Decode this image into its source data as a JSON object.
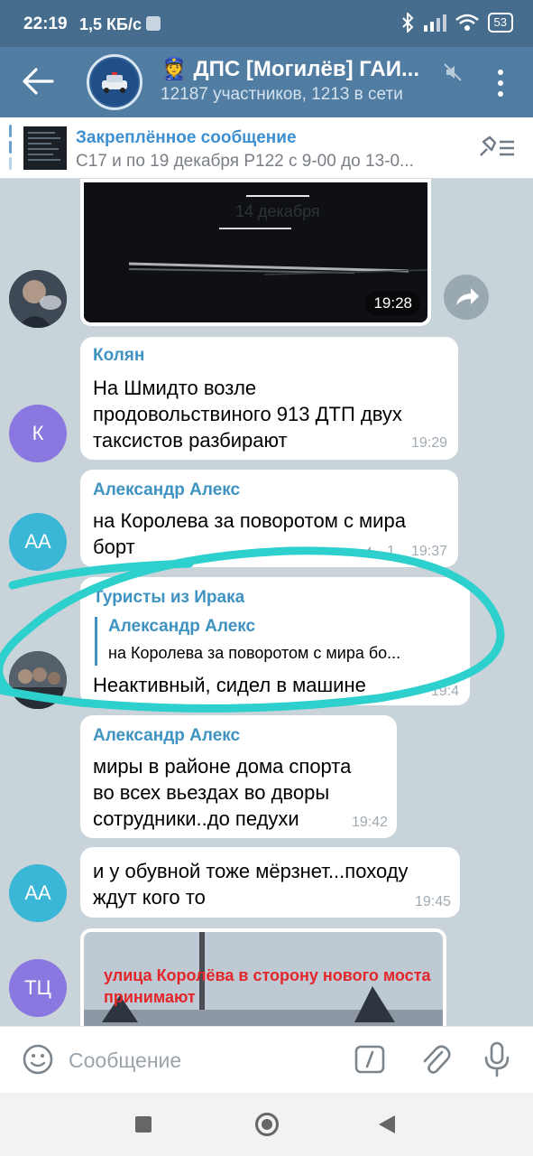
{
  "status_bar": {
    "time": "22:19",
    "speed": "1,5 КБ/с",
    "battery": "53"
  },
  "header": {
    "title": "👮 ДПС [Могилёв] ГАИ...",
    "subtitle": "12187 участников, 1213 в сети"
  },
  "pinned": {
    "title": "Закреплённое сообщение",
    "text": "С17 и по 19 декабря   Р122  с 9-00 до 13-0..."
  },
  "chat": {
    "photo1": {
      "watermark": "14 декабря",
      "time": "19:28"
    },
    "messages": [
      {
        "sender": "Колян",
        "avatar_initials": "К",
        "lines": [
          "На Шмидто возле",
          "продовольствиного 913 ДТП двух",
          "таксистов разбирают"
        ],
        "time": "19:29"
      },
      {
        "sender": "Александр Алекс",
        "avatar_initials": "АА",
        "lines": [
          "на Королева за поворотом с мира",
          "борт"
        ],
        "replies": "1",
        "time": "19:37"
      },
      {
        "sender": "Туристы из Ирака",
        "quote_name": "Александр Алекс",
        "quote_text": "на Королева за поворотом с мира бо...",
        "lines": [
          "Неактивный, сидел в машине"
        ],
        "time": "19:4"
      },
      {
        "sender": "Александр Алекс",
        "lines": [
          "миры в районе дома спорта",
          "во всех вьездах во дворы",
          "сотрудники..до педухи"
        ],
        "time": "19:42"
      },
      {
        "avatar_initials": "АА",
        "lines": [
          "и у обувной тоже мёрзнет...походу",
          "ждут кого то"
        ],
        "time": "19:45"
      }
    ],
    "photo2": {
      "avatar_initials": "ТЦ",
      "caption": "улица Королёва в сторону нового моста принимают"
    }
  },
  "input": {
    "placeholder": "Сообщение"
  },
  "colors": {
    "header": "#517da2",
    "accent": "#3f93c2",
    "avatar_purple": "#8a78e0",
    "avatar_cyan": "#3ab6d6",
    "annotation_circle": "#2dd0cc"
  }
}
